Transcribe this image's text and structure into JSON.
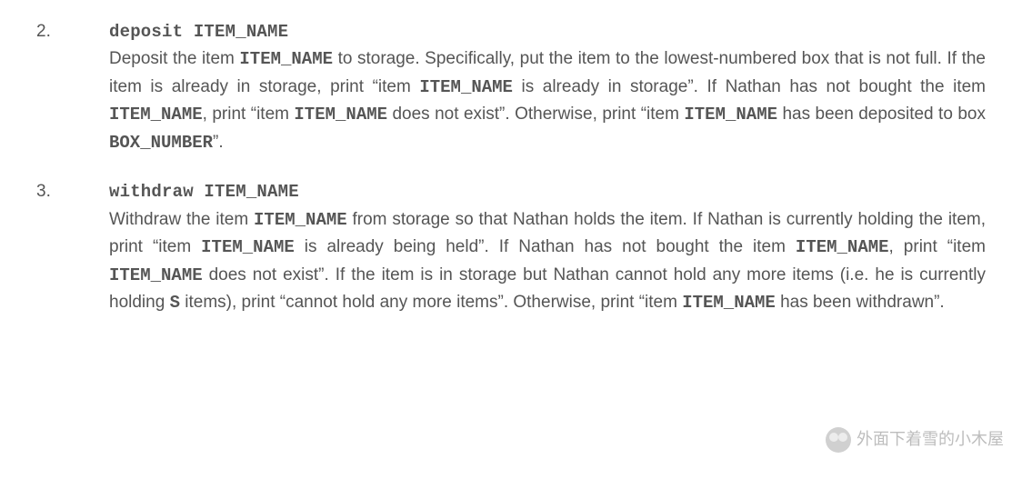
{
  "items": [
    {
      "num": "2.",
      "command": "deposit ITEM_NAME",
      "parts": [
        {
          "t": "Deposit the item "
        },
        {
          "t": "ITEM_NAME",
          "v": true
        },
        {
          "t": " to storage. Specifically, put the item to the lowest-numbered box that is not full. If the item is already in storage, print “item "
        },
        {
          "t": "ITEM_NAME",
          "v": true
        },
        {
          "t": " is already in storage”. If Nathan has not bought the item "
        },
        {
          "t": "ITEM_NAME",
          "v": true
        },
        {
          "t": ", print “item "
        },
        {
          "t": "ITEM_NAME",
          "v": true
        },
        {
          "t": " does not exist”. Otherwise, print “item "
        },
        {
          "t": "ITEM_NAME",
          "v": true
        },
        {
          "t": " has been deposited to box "
        },
        {
          "t": "BOX_NUMBER",
          "v": true
        },
        {
          "t": "”."
        }
      ]
    },
    {
      "num": "3.",
      "command": "withdraw ITEM_NAME",
      "parts": [
        {
          "t": "Withdraw the item "
        },
        {
          "t": "ITEM_NAME",
          "v": true
        },
        {
          "t": " from storage so that Nathan holds the item. If Nathan is currently holding the item, print “item "
        },
        {
          "t": "ITEM_NAME",
          "v": true
        },
        {
          "t": " is already being held”. If Nathan has not bought the item "
        },
        {
          "t": "ITEM_NAME",
          "v": true
        },
        {
          "t": ", print “item "
        },
        {
          "t": "ITEM_NAME",
          "v": true
        },
        {
          "t": " does not exist”. If the item is in storage but Nathan cannot hold any more items (i.e. he is currently holding "
        },
        {
          "t": "S",
          "v": true
        },
        {
          "t": " items), print “cannot hold any more items”. Otherwise, print “item "
        },
        {
          "t": "ITEM_NAME",
          "v": true
        },
        {
          "t": " has been withdrawn”."
        }
      ]
    }
  ],
  "watermark": "外面下着雪的小木屋"
}
